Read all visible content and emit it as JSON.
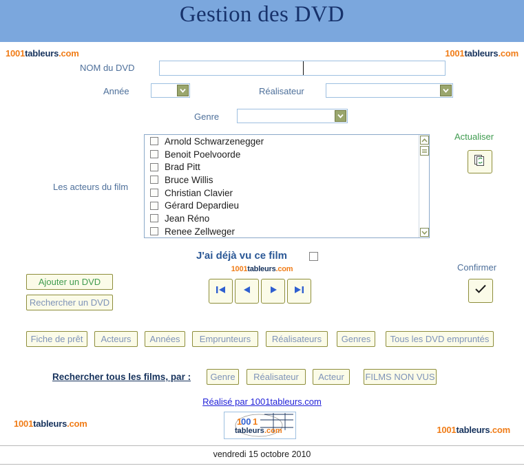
{
  "header": {
    "title": "Gestion des DVD",
    "band_color": "#7ba7dd",
    "title_color": "#17326b"
  },
  "logo": {
    "num": "1001",
    "word": "tableurs",
    "domain": ".com",
    "num_color": "#f07c17",
    "word_color": "#16325c"
  },
  "form": {
    "dvd_name_label": "NOM du DVD",
    "dvd_name_value": "",
    "dvd_name_placeholder": "",
    "annee_label": "Année",
    "annee_value": "",
    "realisateur_label": "Réalisateur",
    "realisateur_value": "",
    "genre_label": "Genre",
    "genre_value": "",
    "actors_label": "Les acteurs du film"
  },
  "actors": [
    {
      "name": "Arnold Schwarzenegger",
      "checked": false
    },
    {
      "name": "Benoit Poelvoorde",
      "checked": false
    },
    {
      "name": "Brad Pitt",
      "checked": false
    },
    {
      "name": "Bruce Willis",
      "checked": false
    },
    {
      "name": "Christian Clavier",
      "checked": false
    },
    {
      "name": "Gérard Depardieu",
      "checked": false
    },
    {
      "name": "Jean Réno",
      "checked": false
    },
    {
      "name": "Renee Zellweger",
      "checked": false
    }
  ],
  "actualiser": {
    "label": "Actualiser",
    "label_color": "#3f9b4f",
    "icon": "refresh-pages-icon"
  },
  "dejavu": {
    "label": "J'ai déjà vu ce film",
    "checked": false
  },
  "navigation": {
    "first": "first-record-icon",
    "prev": "previous-record-icon",
    "next": "next-record-icon",
    "last": "last-record-icon"
  },
  "confirmer": {
    "label": "Confirmer",
    "icon": "checkmark-icon"
  },
  "actions": {
    "ajouter": "Ajouter un DVD",
    "rechercher": "Rechercher un DVD"
  },
  "tables_row": [
    "Fiche de prêt",
    "Acteurs",
    "Années",
    "Emprunteurs",
    "Réalisateurs",
    "Genres",
    "Tous les DVD empruntés"
  ],
  "search_all": {
    "label": "Rechercher tous les films, par :",
    "buttons": [
      "Genre",
      "Réalisateur",
      "Acteur",
      "FILMS NON VUS"
    ]
  },
  "credit": {
    "link_text": "Réalisé par 1001tableurs.com",
    "link_color": "#2020d8"
  },
  "footer": {
    "date": "vendredi 15 octobre 2010"
  }
}
